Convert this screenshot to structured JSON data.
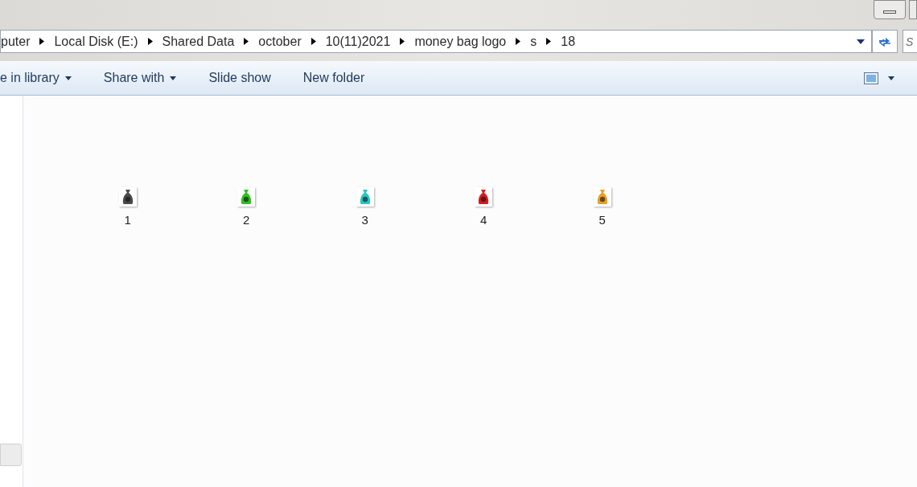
{
  "address_bar": {
    "crumbs": [
      "puter",
      "Local Disk (E:)",
      "Shared Data",
      "october",
      "10(11)2021",
      "money bag logo",
      "s",
      "18"
    ]
  },
  "search": {
    "placeholder": "S"
  },
  "toolbar": {
    "items": [
      {
        "label": "e in library",
        "dropdown": true
      },
      {
        "label": "Share with",
        "dropdown": true
      },
      {
        "label": "Slide show",
        "dropdown": false
      },
      {
        "label": "New folder",
        "dropdown": false
      }
    ]
  },
  "files": [
    {
      "name": "1",
      "color": "#4a4a4a"
    },
    {
      "name": "2",
      "color": "#2fbf1f"
    },
    {
      "name": "3",
      "color": "#27c4c4"
    },
    {
      "name": "4",
      "color": "#d41c1c"
    },
    {
      "name": "5",
      "color": "#e8a02a"
    }
  ]
}
